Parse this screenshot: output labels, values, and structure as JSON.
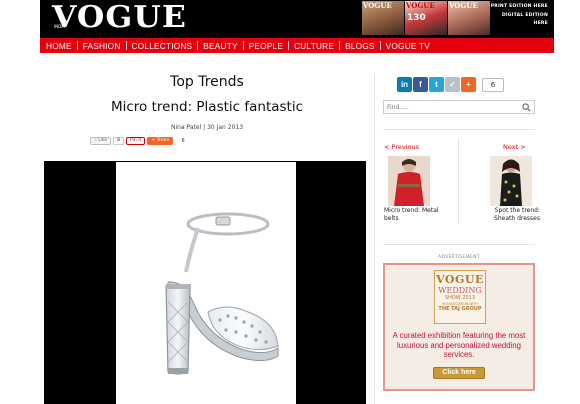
{
  "header": {
    "logo": "VOGUE",
    "logo_sub": "INDIA",
    "edition_links": [
      "PRINT EDITION HERE",
      "DIGITAL EDITION",
      "HERE"
    ],
    "cover_titles": [
      "VOGUE",
      "VOGUE",
      "VOGUE"
    ],
    "cover_badge": "130"
  },
  "nav": {
    "items": [
      "HOME",
      "FASHION",
      "COLLECTIONS",
      "BEAUTY",
      "PEOPLE",
      "CULTURE",
      "BLOGS",
      "VOGUE TV"
    ]
  },
  "article": {
    "section": "Top Trends",
    "title": "Micro trend: Plastic fantastic",
    "byline": "Nina Patel | 30 Jan 2013",
    "social": {
      "like_label": "Like",
      "like_count": "8",
      "pin_label": "Pin it",
      "share_label": "Share",
      "share_count": "6"
    }
  },
  "sidebar": {
    "share_count": "6",
    "share_icons": [
      "in",
      "f",
      "t",
      "✓",
      "+"
    ],
    "search_placeholder": "Find.....",
    "prev_label": "< Previous",
    "next_label": "Next >",
    "prev_caption": "Micro trend: Metal belts",
    "next_caption": "Spot the trend: Sheath dresses",
    "ad_label": "ADVERTISEMENT",
    "ad": {
      "brand": "VOGUE",
      "event": "WEDDING",
      "show": "SHOW 2013",
      "sub": "IN ASSOCIATION WITH",
      "partner": "THE TAJ GROUP",
      "tagline": "A curated exhibition featuring the most luxurious and personalized wedding services.",
      "cta": "Click here"
    }
  },
  "colors": {
    "nav_red": "#e3000f",
    "header_black": "#000000",
    "link_red": "#e3000f",
    "ad_gold": "#c69a36"
  }
}
